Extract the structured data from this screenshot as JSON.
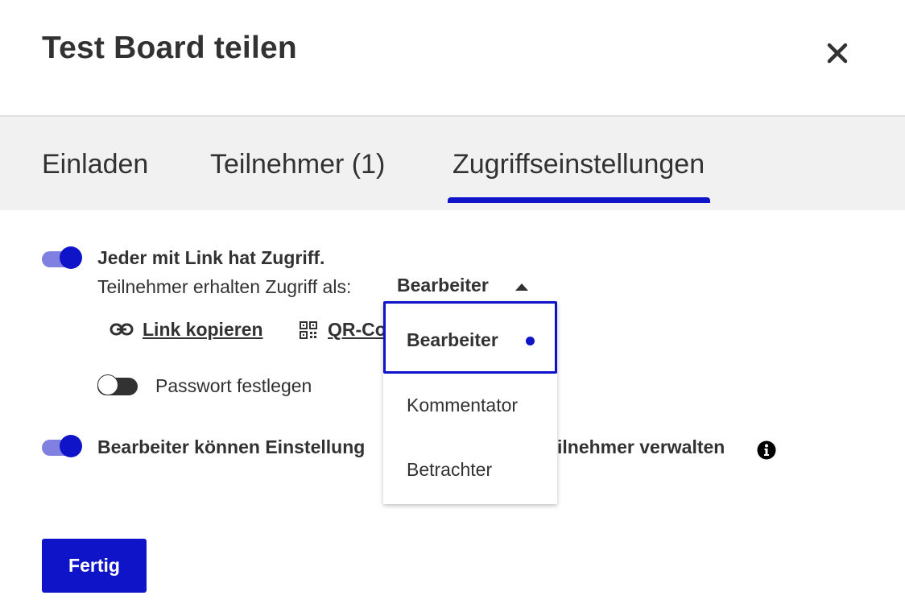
{
  "dialog": {
    "title": "Test Board teilen"
  },
  "tabs": [
    {
      "label": "Einladen"
    },
    {
      "label": "Teilnehmer (1)"
    },
    {
      "label": "Zugriffseinstellungen",
      "active": true
    }
  ],
  "link_access": {
    "enabled": true,
    "label": "Jeder mit Link hat Zugriff.",
    "role_prompt": "Teilnehmer erhalten Zugriff als:",
    "role_value": "Bearbeiter",
    "copy_link_label": "Link kopieren",
    "qr_label": "QR-Co",
    "password_enabled": false,
    "password_label": "Passwort festlegen"
  },
  "role_dropdown": {
    "options": [
      "Bearbeiter",
      "Kommentator",
      "Betrachter"
    ],
    "selected": "Bearbeiter"
  },
  "editors_setting": {
    "enabled": true,
    "label_left": "Bearbeiter können Einstellung",
    "label_right": "ilnehmer verwalten"
  },
  "footer": {
    "done_label": "Fertig"
  },
  "colors": {
    "accent": "#0f14c8",
    "toggle_track_on": "#8080e0",
    "tab_bar_bg": "#f1f1f1",
    "text": "#323232"
  },
  "icons": [
    "close-icon",
    "link-icon",
    "qr-code-icon",
    "caret-up-icon",
    "info-icon",
    "selected-dot-icon"
  ]
}
